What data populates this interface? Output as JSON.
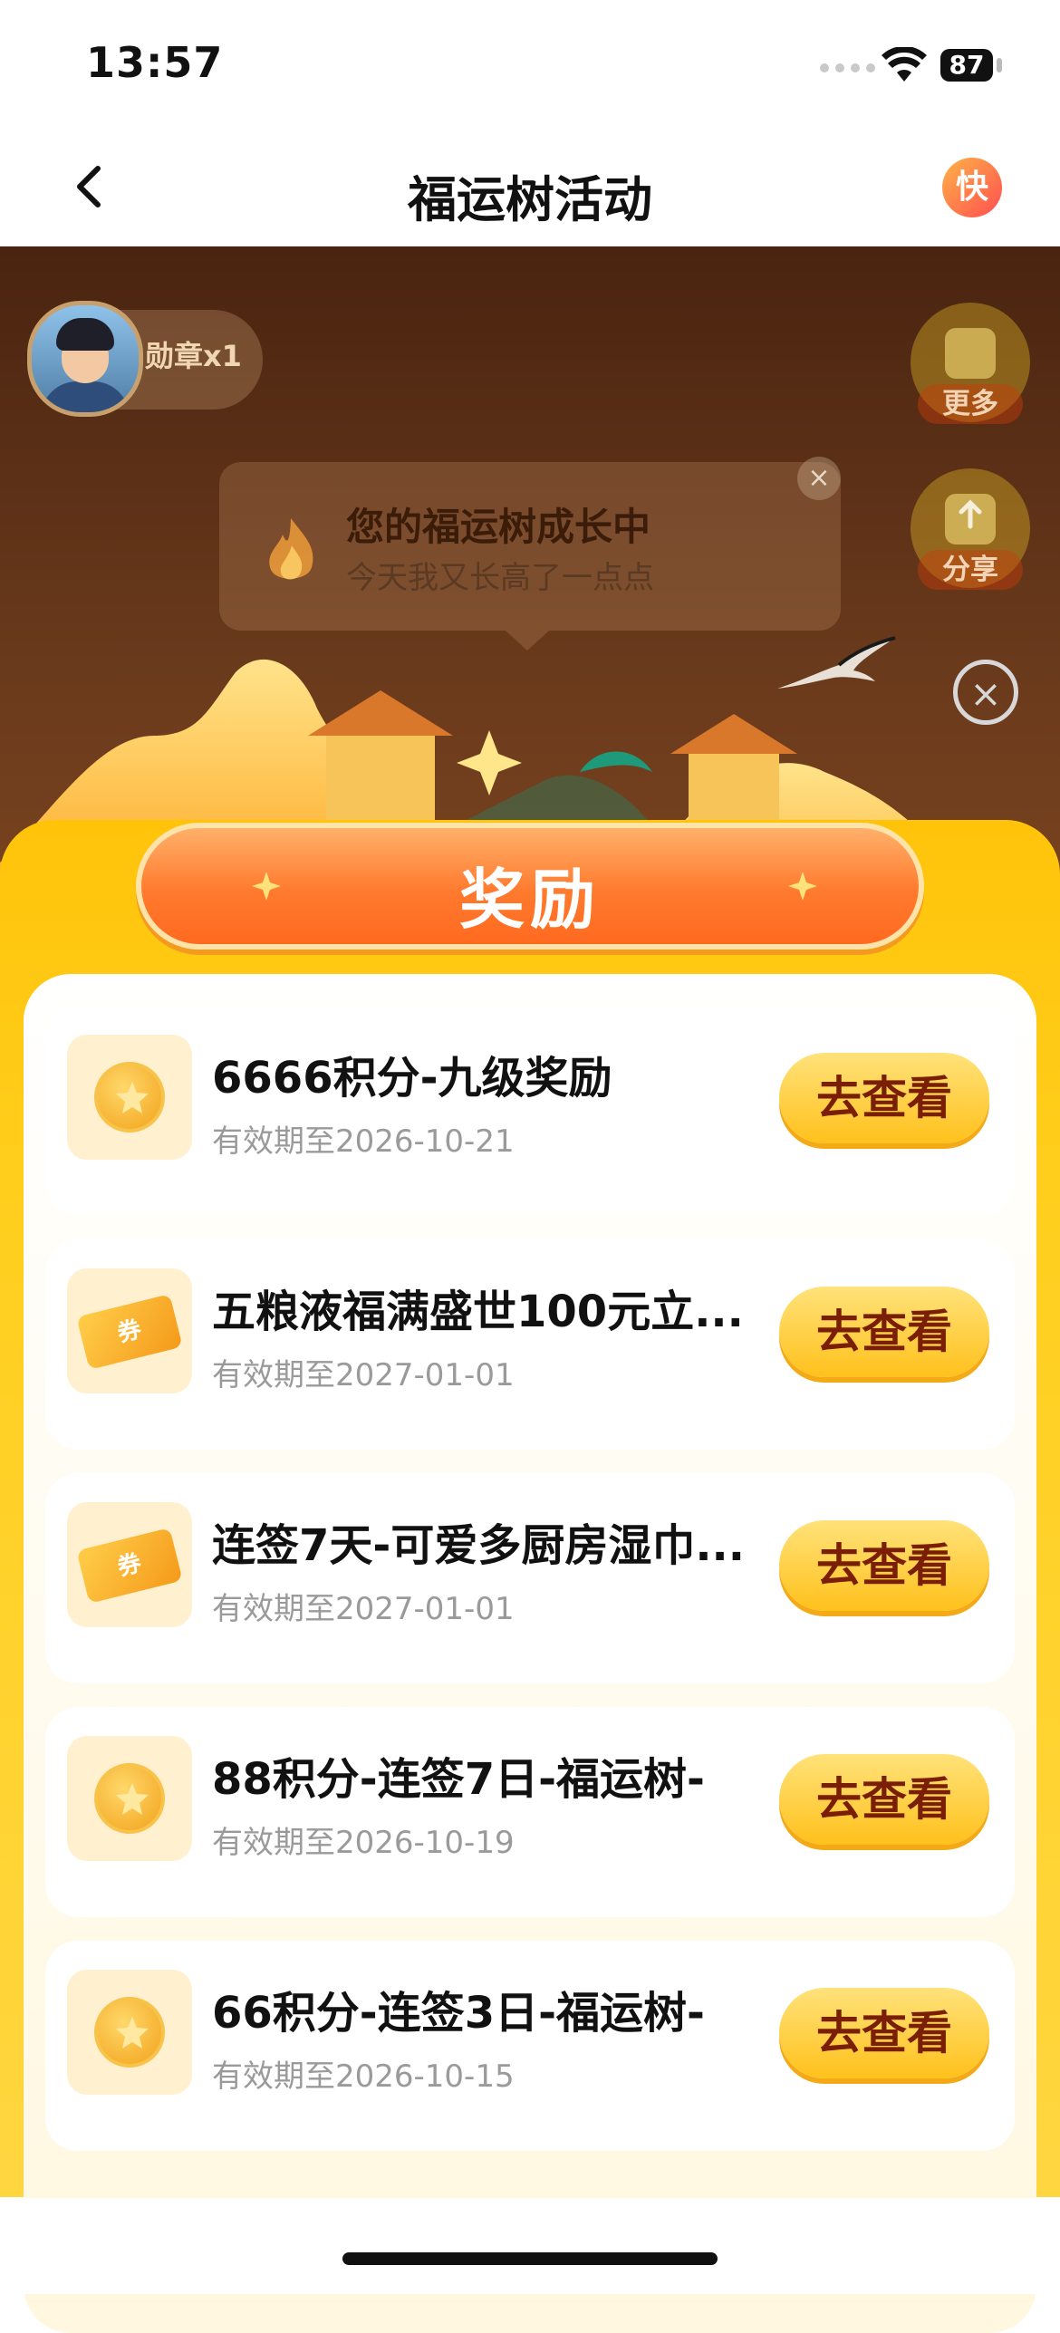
{
  "status_bar": {
    "time": "13:57",
    "battery": "87"
  },
  "nav": {
    "title": "福运树活动",
    "badge": "快"
  },
  "scene": {
    "medal_text": "勋章x1",
    "more_label": "更多",
    "share_label": "分享",
    "bubble_title": "您的福运树成长中",
    "bubble_subtitle": "今天我又长高了一点点",
    "bubble_close": "×",
    "close_symbol": "×"
  },
  "rewards": {
    "title": "奖励",
    "items": [
      {
        "icon": "coin-icon",
        "title": "6666积分-九级奖励",
        "expiry": "有效期至2026-10-21",
        "button": "去查看"
      },
      {
        "icon": "coupon-icon",
        "icon_text": "券",
        "title": "五粮液福满盛世100元立...",
        "expiry": "有效期至2027-01-01",
        "button": "去查看"
      },
      {
        "icon": "coupon-icon",
        "icon_text": "券",
        "title": "连签7天-可爱多厨房湿巾...",
        "expiry": "有效期至2027-01-01",
        "button": "去查看"
      },
      {
        "icon": "coin-icon",
        "title": "88积分-连签7日-福运树-",
        "expiry": "有效期至2026-10-19",
        "button": "去查看"
      },
      {
        "icon": "coin-icon",
        "title": "66积分-连签3日-福运树-",
        "expiry": "有效期至2026-10-15",
        "button": "去查看"
      }
    ]
  },
  "colors": {
    "accent": "#ffc40a",
    "button_text": "#7a1e05",
    "banner": "#ff7a2e"
  }
}
